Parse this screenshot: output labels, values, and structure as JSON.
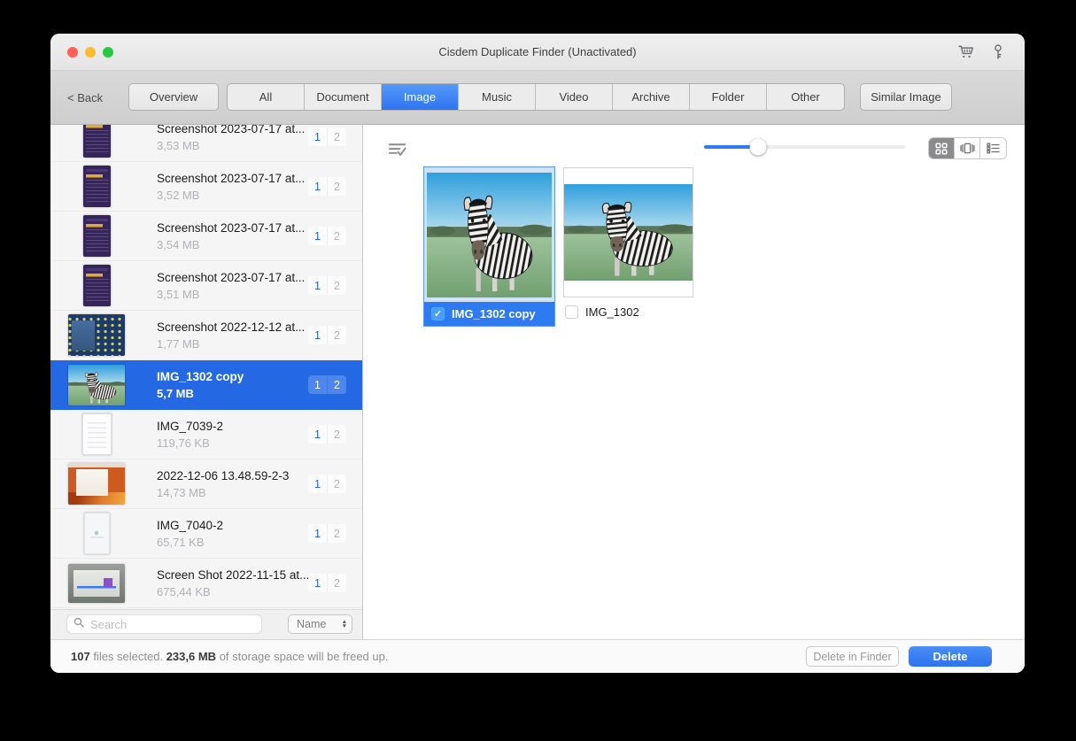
{
  "window": {
    "title": "Cisdem Duplicate Finder (Unactivated)",
    "titlebar_icons": [
      "cart-icon",
      "key-icon"
    ]
  },
  "toolbar": {
    "back_label": "< Back",
    "overview_label": "Overview",
    "segments": [
      "All",
      "Document",
      "Image",
      "Music",
      "Video",
      "Archive",
      "Folder",
      "Other"
    ],
    "selected_segment": "Image",
    "similar_image_label": "Similar Image"
  },
  "sidebar": {
    "items": [
      {
        "name": "Screenshot 2023-07-17 at...",
        "size": "3,53 MB",
        "group_badge": "1",
        "copy_badge": "2",
        "thumb": "purple-screenshot",
        "selected": false
      },
      {
        "name": "Screenshot 2023-07-17 at...",
        "size": "3,52 MB",
        "group_badge": "1",
        "copy_badge": "2",
        "thumb": "purple-screenshot",
        "selected": false
      },
      {
        "name": "Screenshot 2023-07-17 at...",
        "size": "3,54 MB",
        "group_badge": "1",
        "copy_badge": "2",
        "thumb": "purple-screenshot",
        "selected": false
      },
      {
        "name": "Screenshot 2023-07-17 at...",
        "size": "3,51 MB",
        "group_badge": "1",
        "copy_badge": "2",
        "thumb": "purple-screenshot",
        "selected": false
      },
      {
        "name": "Screenshot 2022-12-12 at...",
        "size": "1,77 MB",
        "group_badge": "1",
        "copy_badge": "2",
        "thumb": "blue-desktop",
        "selected": false
      },
      {
        "name": "IMG_1302 copy",
        "size": "5,7 MB",
        "group_badge": "1",
        "copy_badge": "2",
        "thumb": "zebra-photo",
        "selected": true
      },
      {
        "name": "IMG_7039-2",
        "size": "119,76 KB",
        "group_badge": "1",
        "copy_badge": "2",
        "thumb": "white-document",
        "selected": false
      },
      {
        "name": "2022-12-06 13.48.59-2-3",
        "size": "14,73 MB",
        "group_badge": "1",
        "copy_badge": "2",
        "thumb": "orange-desktop",
        "selected": false
      },
      {
        "name": "IMG_7040-2",
        "size": "65,71 KB",
        "group_badge": "1",
        "copy_badge": "2",
        "thumb": "light-document",
        "selected": false
      },
      {
        "name": "Screen Shot 2022-11-15 at...",
        "size": "675,44 KB",
        "group_badge": "1",
        "copy_badge": "2",
        "thumb": "gray-window",
        "selected": false
      }
    ],
    "search": {
      "placeholder": "Search"
    },
    "sort": {
      "value": "Name"
    }
  },
  "main": {
    "header_icons": [
      "select-all-icon"
    ],
    "slider_percent": 27,
    "view_modes": [
      "grid",
      "coverflow",
      "list"
    ],
    "active_view": "grid",
    "cards": [
      {
        "label": "IMG_1302 copy",
        "checked": true,
        "selected": true
      },
      {
        "label": "IMG_1302",
        "checked": false,
        "selected": false
      }
    ]
  },
  "footer": {
    "selected_count": "107",
    "status_mid": " files selected. ",
    "freed_size": "233,6 MB",
    "status_end": " of storage space will be freed up.",
    "delete_in_finder_label": "Delete in Finder",
    "delete_label": "Delete"
  },
  "colors": {
    "accent_blue": "#2e7bf0",
    "selected_row_blue": "#2468e4",
    "segment_selected_blue": "#3d7ef7",
    "badge_number_blue": "#2562ee",
    "traffic_red": "#ff5f57",
    "traffic_yellow": "#febc2e",
    "traffic_green": "#28c840"
  }
}
